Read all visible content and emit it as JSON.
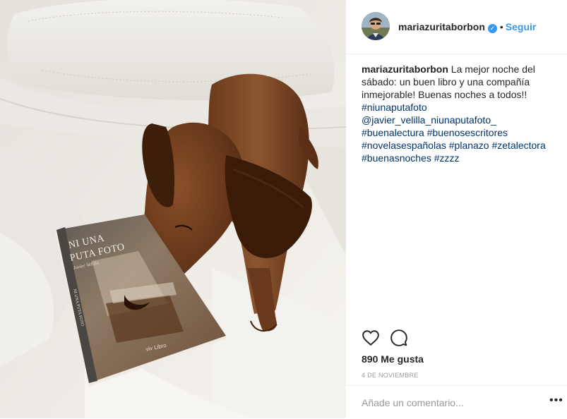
{
  "post": {
    "username": "mariazuritaborbon",
    "verified": true,
    "separator": "•",
    "follow_label": "Seguir",
    "caption": {
      "author": "mariazuritaborbon",
      "text": "La mejor noche del sábado: un buen libro y una compañía inmejorable! Buenas noches a todos!!",
      "hashtags": [
        "#niunaputafoto",
        "@javier_velilla_niunaputafoto_",
        "#buenalectura",
        "#buenosescritores",
        "#novelasespañolas",
        "#planazo",
        "#zetalectora",
        "#buenasnoches",
        "#zzzz"
      ]
    },
    "likes_text": "890 Me gusta",
    "date_text": "4 DE NOVIEMBRE",
    "comment_placeholder": "Añade un comentario...",
    "more_options": "•••"
  },
  "photo": {
    "book_title_line1": "NI UNA",
    "book_title_line2": "PUTA FOTO",
    "book_author": "Javier Velilla",
    "book_publisher": "viv Libro",
    "book_spine": "NI UNA PUTA FOTO"
  },
  "icons": {
    "like": "heart-outline-icon",
    "comment": "comment-bubble-icon",
    "verified": "verified-badge-icon",
    "more": "more-options-icon"
  },
  "colors": {
    "link_blue": "#3897f0",
    "hashtag_blue": "#003569",
    "text": "#262626",
    "muted": "#999999",
    "divider": "#efefef"
  }
}
